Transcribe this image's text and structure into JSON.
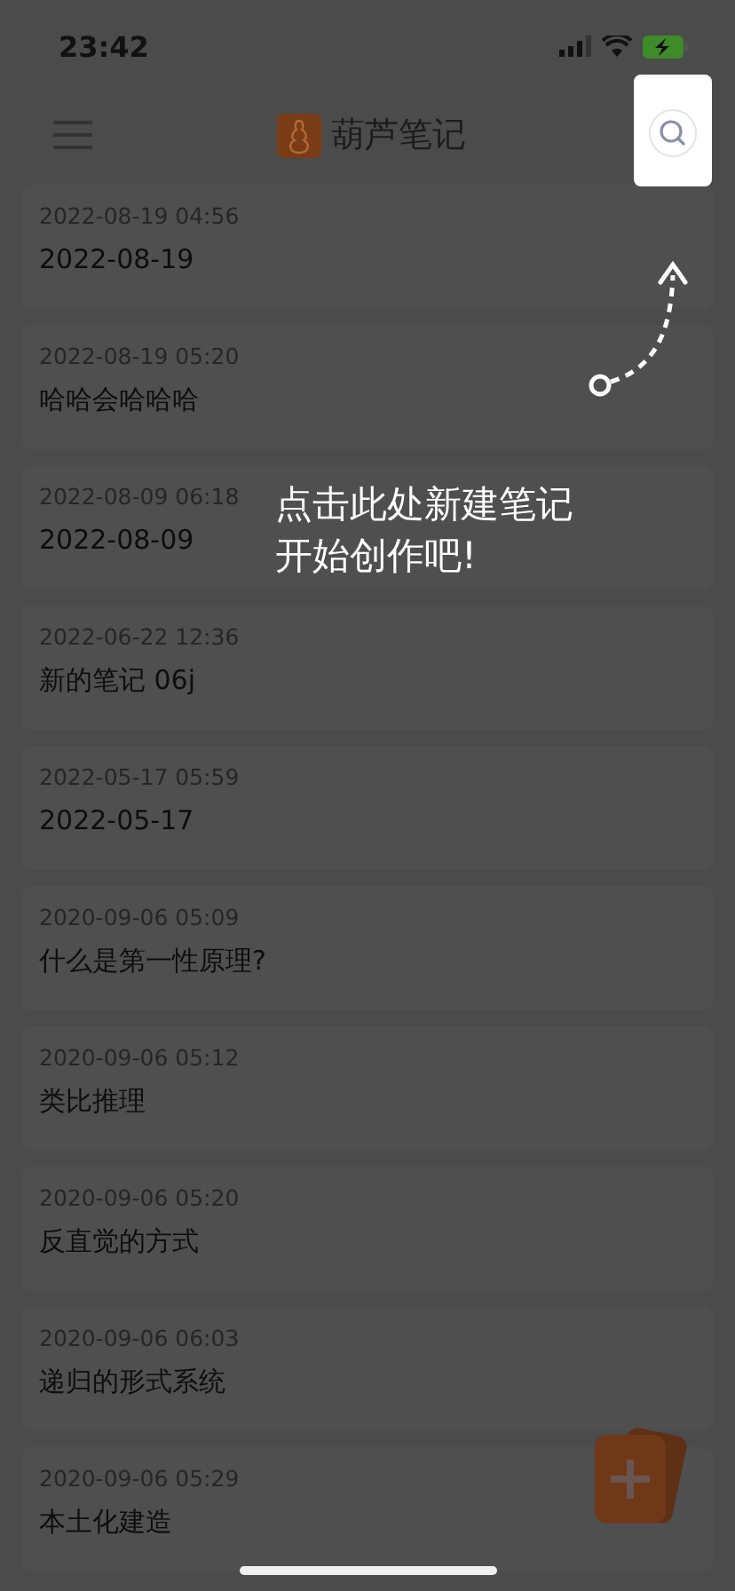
{
  "status_bar": {
    "time": "23:42"
  },
  "header": {
    "title": "葫芦笔记"
  },
  "notes": [
    {
      "time": "2022-08-19 04:56",
      "title": "2022-08-19"
    },
    {
      "time": "2022-08-19 05:20",
      "title": "哈哈会哈哈哈"
    },
    {
      "time": "2022-08-09 06:18",
      "title": "2022-08-09"
    },
    {
      "time": "2022-06-22 12:36",
      "title": "新的笔记 06j"
    },
    {
      "time": "2022-05-17 05:59",
      "title": "2022-05-17"
    },
    {
      "time": "2020-09-06 05:09",
      "title": "什么是第一性原理?"
    },
    {
      "time": "2020-09-06 05:12",
      "title": "类比推理"
    },
    {
      "time": "2020-09-06 05:20",
      "title": "反直觉的方式"
    },
    {
      "time": "2020-09-06 06:03",
      "title": "递归的形式系统"
    },
    {
      "time": "2020-09-06 05:29",
      "title": "本土化建造"
    }
  ],
  "guide": {
    "lines": [
      "点击此处新建笔记",
      "开始创作吧!"
    ]
  }
}
